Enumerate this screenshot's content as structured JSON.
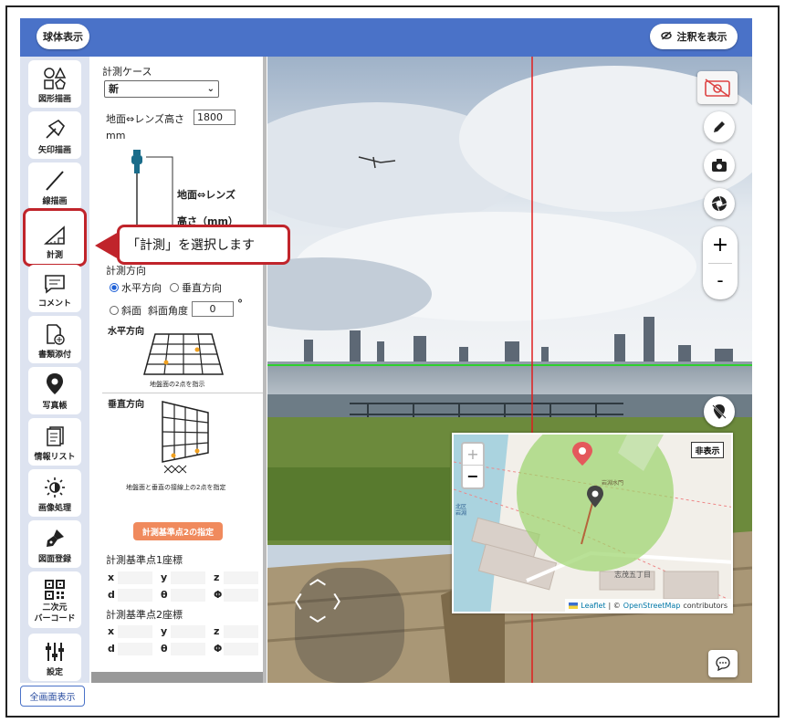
{
  "header": {
    "globe_button": "球体表示",
    "annotation_toggle": "注釈を表示"
  },
  "toolbar": {
    "items": [
      {
        "label": "図形描画",
        "icon": "shapes-icon"
      },
      {
        "label": "矢印描画",
        "icon": "arrow-icon"
      },
      {
        "label": "線描画",
        "icon": "line-icon"
      },
      {
        "label": "計測",
        "icon": "measure-icon"
      },
      {
        "label": "コメント",
        "icon": "comment-icon"
      },
      {
        "label": "書類添付",
        "icon": "document-attach-icon"
      },
      {
        "label": "写真帳",
        "icon": "location-pin-icon"
      },
      {
        "label": "情報リスト",
        "icon": "info-list-icon"
      },
      {
        "label": "画像処理",
        "icon": "brightness-icon"
      },
      {
        "label": "図面登録",
        "icon": "pen-nib-icon"
      },
      {
        "label": "二次元\nバーコード",
        "icon": "qr-code-icon"
      },
      {
        "label": "設定",
        "icon": "sliders-icon"
      }
    ],
    "fullscreen_button": "全画面表示"
  },
  "callout": {
    "text": "「計測」を選択します"
  },
  "measure_panel": {
    "case_label": "計測ケース",
    "case_value": "新",
    "height_label": "地面⇔レンズ高さ",
    "height_value": "1800",
    "height_unit": "mm",
    "diagram_label_1": "地面⇔レンズ",
    "diagram_label_2": "高さ（mm）",
    "direction_label": "計測方向",
    "direction_options": [
      "水平方向",
      "垂直方向"
    ],
    "direction_selected": "水平方向",
    "slope_option": "斜面",
    "slope_angle_label": "斜面角度",
    "slope_angle_value": "0",
    "degree_symbol": "°",
    "horizontal_title": "水平方向",
    "horizontal_caption": "地盤面の2点を指示",
    "vertical_title": "垂直方向",
    "vertical_caption": "地盤面と垂直の接線上の2点を指定",
    "reference_button": "計測基準点2の指定",
    "point1_title": "計測基準点1座標",
    "point2_title": "計測基準点2座標",
    "coord_labels_row1": [
      "x",
      "y",
      "z"
    ],
    "coord_labels_row2": [
      "d",
      "θ",
      "Φ"
    ]
  },
  "map": {
    "zoom_in": "+",
    "zoom_out": "−",
    "hide_button": "非表示",
    "attribution_leaflet": "Leaflet",
    "attribution_sep": "| ©",
    "attribution_osm": "OpenStreetMap",
    "attribution_tail": "contributors",
    "place_label_1": "志茂五丁目",
    "place_label_2": "岩淵水門",
    "place_label_3": "北区岩淵"
  },
  "pano_controls": {
    "zoom_in": "+",
    "zoom_out": "-"
  },
  "colors": {
    "header_blue": "#4a72c8",
    "highlight_red": "#c0242b",
    "button_orange": "#f08a5d",
    "map_circle": "#9bd46b"
  }
}
